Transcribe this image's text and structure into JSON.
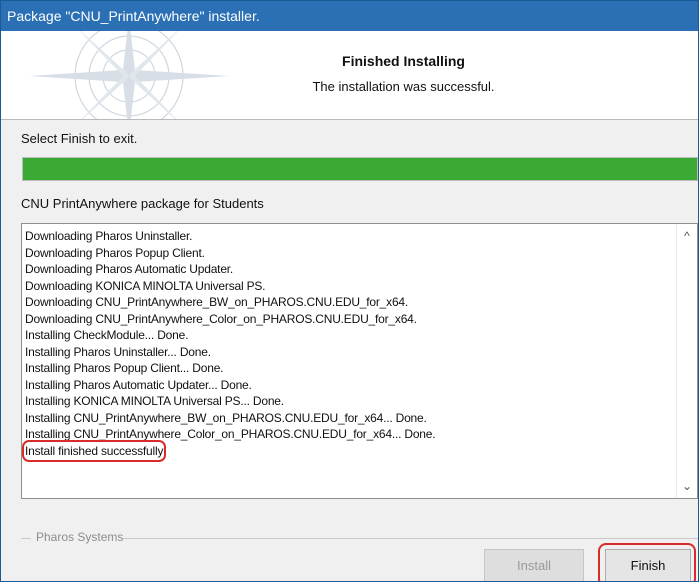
{
  "window": {
    "title": "Package \"CNU_PrintAnywhere\" installer."
  },
  "header": {
    "title": "Finished Installing",
    "subtitle": "The installation was successful."
  },
  "status": {
    "select_text": "Select Finish to exit.",
    "progress_percent": 100,
    "progress_color": "#3aaa35",
    "package_label": "CNU PrintAnywhere package for Students"
  },
  "log": {
    "lines": [
      "Downloading Pharos Uninstaller.",
      "Downloading Pharos Popup Client.",
      "Downloading Pharos Automatic Updater.",
      "Downloading KONICA MINOLTA Universal PS.",
      "Downloading CNU_PrintAnywhere_BW_on_PHAROS.CNU.EDU_for_x64.",
      "Downloading CNU_PrintAnywhere_Color_on_PHAROS.CNU.EDU_for_x64.",
      "Installing CheckModule... Done.",
      "Installing Pharos Uninstaller... Done.",
      "Installing Pharos Popup Client... Done.",
      "Installing Pharos Automatic Updater... Done.",
      "Installing KONICA MINOLTA Universal PS... Done.",
      "Installing CNU_PrintAnywhere_BW_on_PHAROS.CNU.EDU_for_x64... Done.",
      "Installing CNU_PrintAnywhere_Color_on_PHAROS.CNU.EDU_for_x64... Done.",
      "Install finished successfully"
    ],
    "highlight_color": "#d82c2c",
    "scroll_up_icon": "scroll-up-arrow-icon",
    "scroll_down_icon": "scroll-down-arrow-icon"
  },
  "footer": {
    "group_label": "Pharos Systems",
    "install_label": "Install",
    "finish_label": "Finish"
  }
}
